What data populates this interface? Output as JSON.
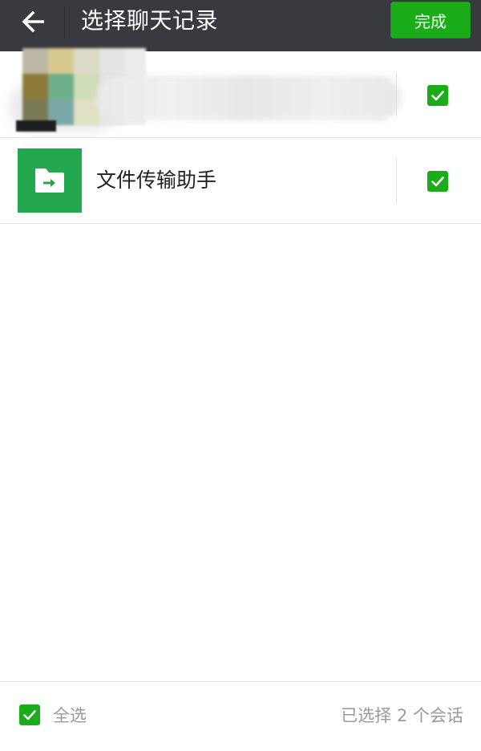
{
  "header": {
    "title": "选择聊天记录",
    "back_icon": "arrow-left-icon",
    "done_label": "完成",
    "background": "#393a3f",
    "accent": "#1aad19"
  },
  "list": {
    "items": [
      {
        "name": "",
        "avatar": "pixelated-avatar",
        "checked": true
      },
      {
        "name": "文件传输助手",
        "avatar": "file-transfer-folder-icon",
        "avatar_color": "#23a850",
        "checked": true
      }
    ]
  },
  "footer": {
    "select_all_label": "全选",
    "select_all_checked": true,
    "selected_count_text": "已选择 2 个会话"
  }
}
